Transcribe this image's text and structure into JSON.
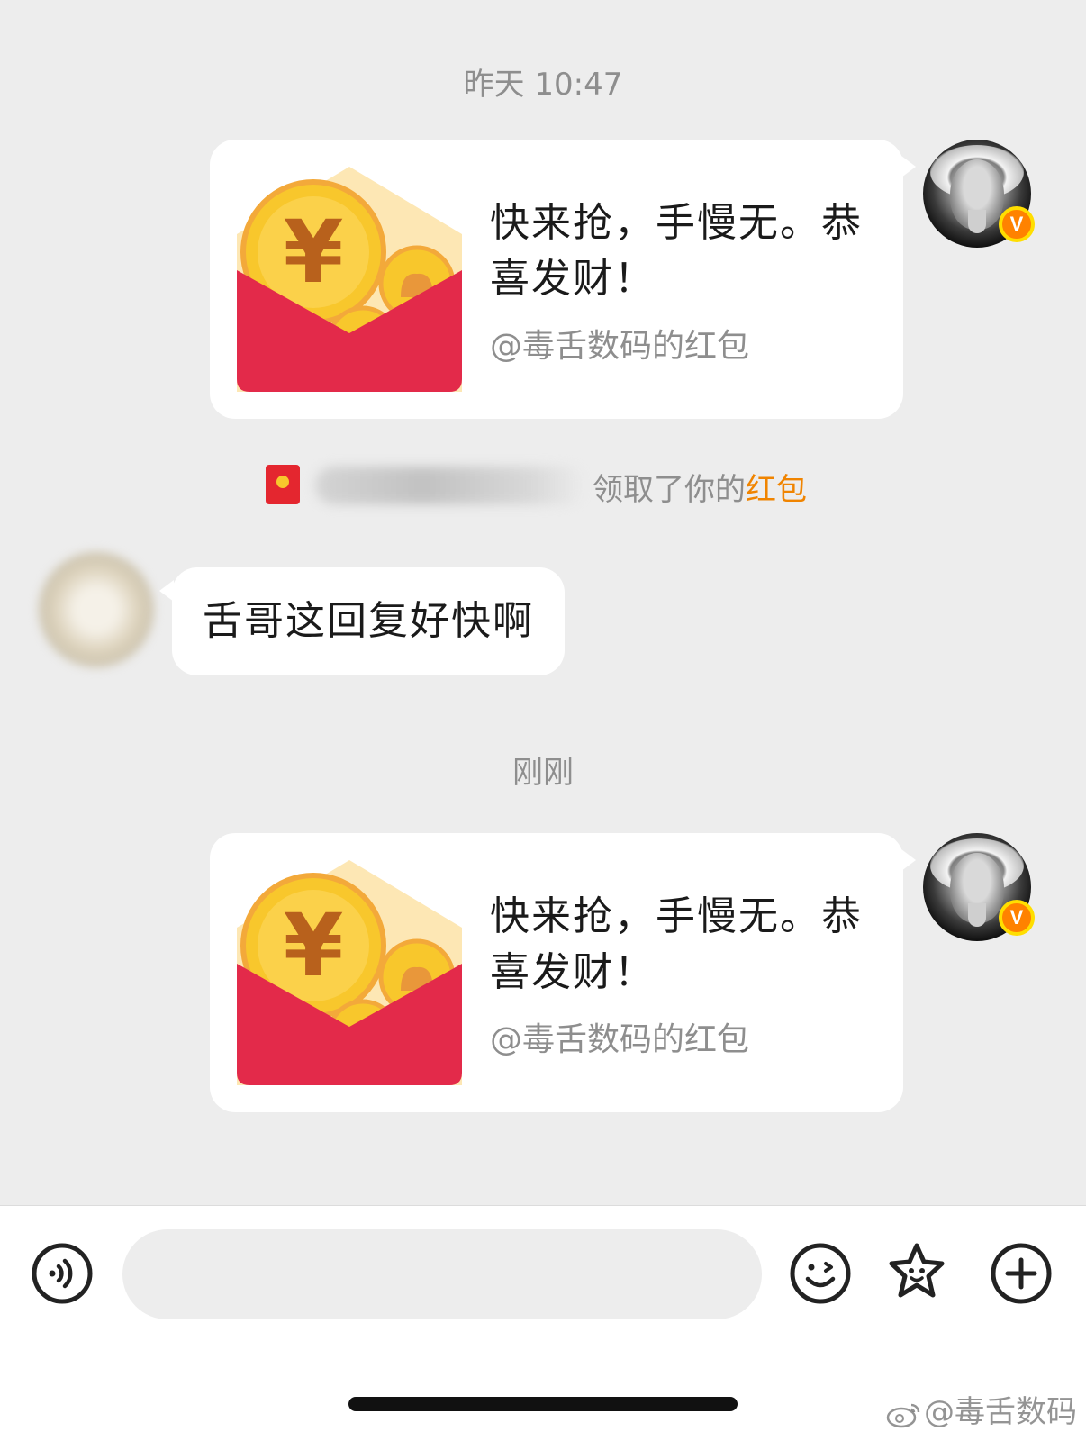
{
  "colors": {
    "background": "#ededed",
    "bubble": "#ffffff",
    "packet_red": "#e4262f",
    "coin_gold": "#f8c72c",
    "accent_orange": "#f08400",
    "timestamp_gray": "#8e8e8e"
  },
  "messages": [
    {
      "timestamp": "昨天 10:47",
      "sender": "me",
      "type": "red-packet",
      "title": "快来抢，手慢无。恭喜发财！",
      "subtitle": "@毒舌数码的红包"
    },
    {
      "sender": "system",
      "type": "claim-notice",
      "text": "领取了你的",
      "link": "红包"
    },
    {
      "sender": "other",
      "type": "text",
      "text": "舌哥这回复好快啊"
    },
    {
      "timestamp": "刚刚",
      "sender": "me",
      "type": "red-packet",
      "title": "快来抢，手慢无。恭喜发财！",
      "subtitle": "@毒舌数码的红包"
    }
  ],
  "avatar_badge": "V",
  "input_bar": {
    "placeholder": "",
    "icons": [
      "voice-icon",
      "emoji-icon",
      "sticker-icon",
      "plus-icon"
    ]
  },
  "watermark": "@毒舌数码"
}
